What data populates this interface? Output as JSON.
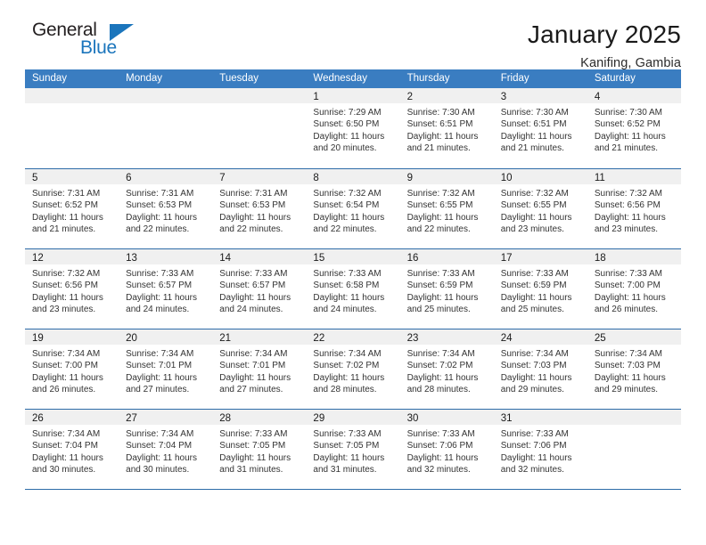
{
  "brand": {
    "name_part1": "General",
    "name_part2": "Blue",
    "triangle_color": "#1b75bc",
    "text_color": "#231f20"
  },
  "header": {
    "month_title": "January 2025",
    "location": "Kanifing, Gambia",
    "accent_color": "#3a7dc1",
    "rule_color": "#2e6ca8"
  },
  "weekday_headers": [
    "Sunday",
    "Monday",
    "Tuesday",
    "Wednesday",
    "Thursday",
    "Friday",
    "Saturday"
  ],
  "labels": {
    "sunrise_prefix": "Sunrise:",
    "sunset_prefix": "Sunset:",
    "daylight_prefix": "Daylight:"
  },
  "weeks": [
    [
      {
        "day": "",
        "lines": []
      },
      {
        "day": "",
        "lines": []
      },
      {
        "day": "",
        "lines": []
      },
      {
        "day": "1",
        "lines": [
          "Sunrise: 7:29 AM",
          "Sunset: 6:50 PM",
          "Daylight: 11 hours",
          "and 20 minutes."
        ]
      },
      {
        "day": "2",
        "lines": [
          "Sunrise: 7:30 AM",
          "Sunset: 6:51 PM",
          "Daylight: 11 hours",
          "and 21 minutes."
        ]
      },
      {
        "day": "3",
        "lines": [
          "Sunrise: 7:30 AM",
          "Sunset: 6:51 PM",
          "Daylight: 11 hours",
          "and 21 minutes."
        ]
      },
      {
        "day": "4",
        "lines": [
          "Sunrise: 7:30 AM",
          "Sunset: 6:52 PM",
          "Daylight: 11 hours",
          "and 21 minutes."
        ]
      }
    ],
    [
      {
        "day": "5",
        "lines": [
          "Sunrise: 7:31 AM",
          "Sunset: 6:52 PM",
          "Daylight: 11 hours",
          "and 21 minutes."
        ]
      },
      {
        "day": "6",
        "lines": [
          "Sunrise: 7:31 AM",
          "Sunset: 6:53 PM",
          "Daylight: 11 hours",
          "and 22 minutes."
        ]
      },
      {
        "day": "7",
        "lines": [
          "Sunrise: 7:31 AM",
          "Sunset: 6:53 PM",
          "Daylight: 11 hours",
          "and 22 minutes."
        ]
      },
      {
        "day": "8",
        "lines": [
          "Sunrise: 7:32 AM",
          "Sunset: 6:54 PM",
          "Daylight: 11 hours",
          "and 22 minutes."
        ]
      },
      {
        "day": "9",
        "lines": [
          "Sunrise: 7:32 AM",
          "Sunset: 6:55 PM",
          "Daylight: 11 hours",
          "and 22 minutes."
        ]
      },
      {
        "day": "10",
        "lines": [
          "Sunrise: 7:32 AM",
          "Sunset: 6:55 PM",
          "Daylight: 11 hours",
          "and 23 minutes."
        ]
      },
      {
        "day": "11",
        "lines": [
          "Sunrise: 7:32 AM",
          "Sunset: 6:56 PM",
          "Daylight: 11 hours",
          "and 23 minutes."
        ]
      }
    ],
    [
      {
        "day": "12",
        "lines": [
          "Sunrise: 7:32 AM",
          "Sunset: 6:56 PM",
          "Daylight: 11 hours",
          "and 23 minutes."
        ]
      },
      {
        "day": "13",
        "lines": [
          "Sunrise: 7:33 AM",
          "Sunset: 6:57 PM",
          "Daylight: 11 hours",
          "and 24 minutes."
        ]
      },
      {
        "day": "14",
        "lines": [
          "Sunrise: 7:33 AM",
          "Sunset: 6:57 PM",
          "Daylight: 11 hours",
          "and 24 minutes."
        ]
      },
      {
        "day": "15",
        "lines": [
          "Sunrise: 7:33 AM",
          "Sunset: 6:58 PM",
          "Daylight: 11 hours",
          "and 24 minutes."
        ]
      },
      {
        "day": "16",
        "lines": [
          "Sunrise: 7:33 AM",
          "Sunset: 6:59 PM",
          "Daylight: 11 hours",
          "and 25 minutes."
        ]
      },
      {
        "day": "17",
        "lines": [
          "Sunrise: 7:33 AM",
          "Sunset: 6:59 PM",
          "Daylight: 11 hours",
          "and 25 minutes."
        ]
      },
      {
        "day": "18",
        "lines": [
          "Sunrise: 7:33 AM",
          "Sunset: 7:00 PM",
          "Daylight: 11 hours",
          "and 26 minutes."
        ]
      }
    ],
    [
      {
        "day": "19",
        "lines": [
          "Sunrise: 7:34 AM",
          "Sunset: 7:00 PM",
          "Daylight: 11 hours",
          "and 26 minutes."
        ]
      },
      {
        "day": "20",
        "lines": [
          "Sunrise: 7:34 AM",
          "Sunset: 7:01 PM",
          "Daylight: 11 hours",
          "and 27 minutes."
        ]
      },
      {
        "day": "21",
        "lines": [
          "Sunrise: 7:34 AM",
          "Sunset: 7:01 PM",
          "Daylight: 11 hours",
          "and 27 minutes."
        ]
      },
      {
        "day": "22",
        "lines": [
          "Sunrise: 7:34 AM",
          "Sunset: 7:02 PM",
          "Daylight: 11 hours",
          "and 28 minutes."
        ]
      },
      {
        "day": "23",
        "lines": [
          "Sunrise: 7:34 AM",
          "Sunset: 7:02 PM",
          "Daylight: 11 hours",
          "and 28 minutes."
        ]
      },
      {
        "day": "24",
        "lines": [
          "Sunrise: 7:34 AM",
          "Sunset: 7:03 PM",
          "Daylight: 11 hours",
          "and 29 minutes."
        ]
      },
      {
        "day": "25",
        "lines": [
          "Sunrise: 7:34 AM",
          "Sunset: 7:03 PM",
          "Daylight: 11 hours",
          "and 29 minutes."
        ]
      }
    ],
    [
      {
        "day": "26",
        "lines": [
          "Sunrise: 7:34 AM",
          "Sunset: 7:04 PM",
          "Daylight: 11 hours",
          "and 30 minutes."
        ]
      },
      {
        "day": "27",
        "lines": [
          "Sunrise: 7:34 AM",
          "Sunset: 7:04 PM",
          "Daylight: 11 hours",
          "and 30 minutes."
        ]
      },
      {
        "day": "28",
        "lines": [
          "Sunrise: 7:33 AM",
          "Sunset: 7:05 PM",
          "Daylight: 11 hours",
          "and 31 minutes."
        ]
      },
      {
        "day": "29",
        "lines": [
          "Sunrise: 7:33 AM",
          "Sunset: 7:05 PM",
          "Daylight: 11 hours",
          "and 31 minutes."
        ]
      },
      {
        "day": "30",
        "lines": [
          "Sunrise: 7:33 AM",
          "Sunset: 7:06 PM",
          "Daylight: 11 hours",
          "and 32 minutes."
        ]
      },
      {
        "day": "31",
        "lines": [
          "Sunrise: 7:33 AM",
          "Sunset: 7:06 PM",
          "Daylight: 11 hours",
          "and 32 minutes."
        ]
      },
      {
        "day": "",
        "lines": []
      }
    ]
  ]
}
